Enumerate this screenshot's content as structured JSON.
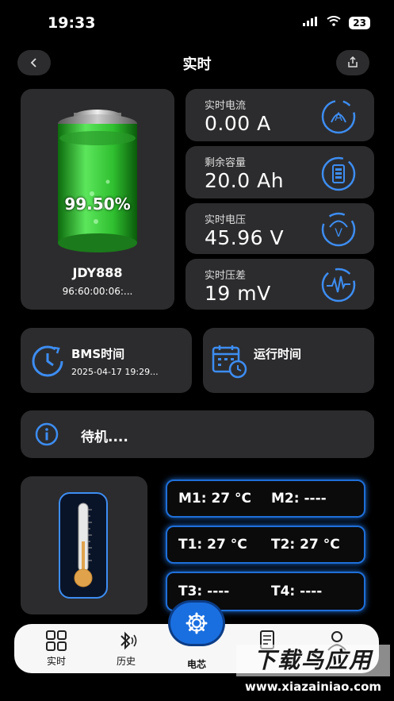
{
  "status": {
    "time": "19:33",
    "battery": "23"
  },
  "header": {
    "title": "实时"
  },
  "battery": {
    "percent_label": "99.50%",
    "level": 0.995,
    "name": "JDY888",
    "mac": "96:60:00:06:..."
  },
  "metrics": [
    {
      "label": "实时电流",
      "value": "0.00 A",
      "icon": "ammeter-icon"
    },
    {
      "label": "剩余容量",
      "value": "20.0 Ah",
      "icon": "battery-capacity-icon"
    },
    {
      "label": "实时电压",
      "value": "45.96 V",
      "icon": "voltmeter-icon"
    },
    {
      "label": "实时压差",
      "value": "19 mV",
      "icon": "wave-gauge-icon"
    }
  ],
  "bms_time": {
    "title": "BMS时间",
    "value": "2025-04-17 19:29..."
  },
  "run_time": {
    "title": "运行时间"
  },
  "status_bar": {
    "text": "待机...."
  },
  "temps": {
    "m1": "M1:  27 °C",
    "m2": "M2: ----",
    "t1": "T1:  27 °C",
    "t2": "T2: 27 °C",
    "t3": "T3: ----",
    "t4": "T4: ----"
  },
  "tabs": [
    {
      "label": "实时"
    },
    {
      "label": "历史"
    },
    {
      "label": "电芯"
    },
    {
      "label": ""
    },
    {
      "label": ""
    }
  ],
  "watermark": {
    "text1": "下载鸟应用",
    "text2": "www.xiazainiao.com"
  }
}
